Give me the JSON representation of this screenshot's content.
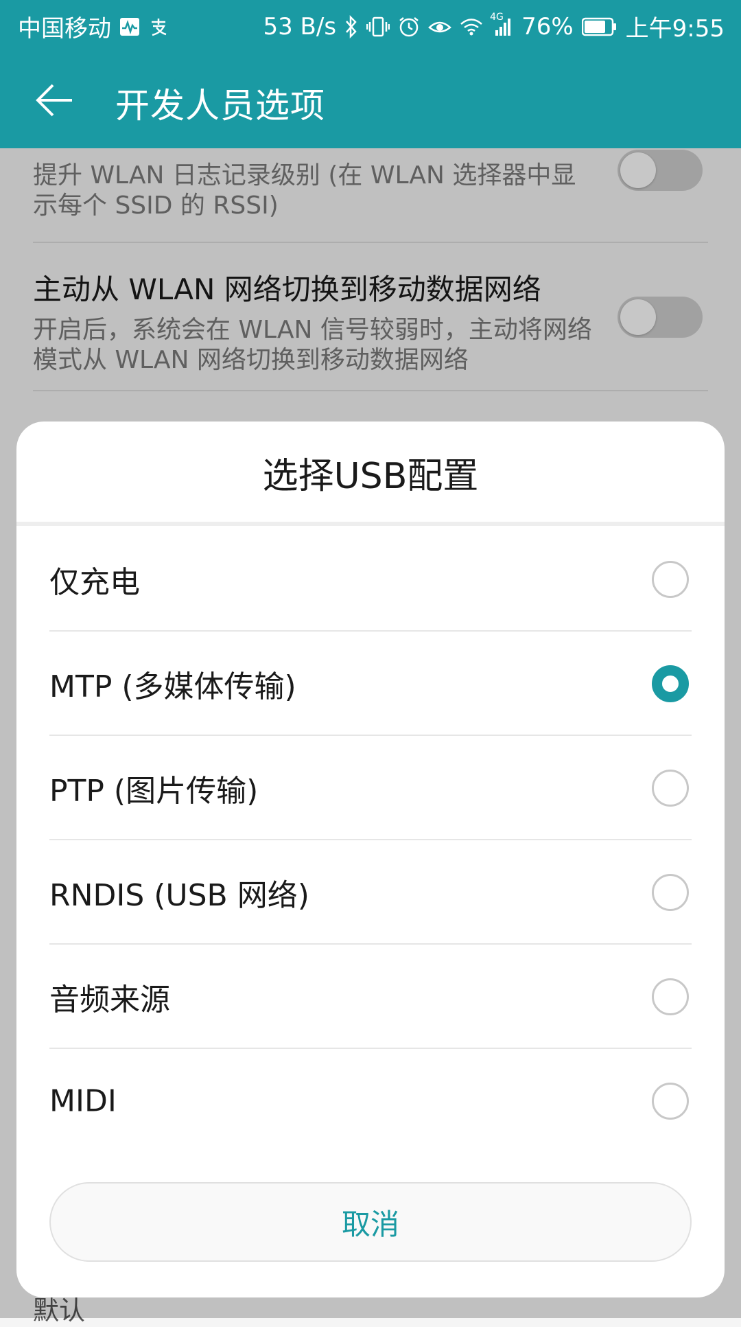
{
  "status_bar": {
    "carrier": "中国移动",
    "net_speed": "53 B/s",
    "network_type": "4G",
    "battery": "76%",
    "time": "上午9:55",
    "icons": [
      "activity-icon",
      "alipay-icon",
      "bluetooth-icon",
      "vibrate-icon",
      "alarm-icon",
      "eye-comfort-icon",
      "wifi-icon",
      "signal-icon",
      "battery-icon"
    ]
  },
  "app_bar": {
    "title": "开发人员选项",
    "back_icon": "arrow-left-icon"
  },
  "settings": {
    "items": [
      {
        "summary": "提升 WLAN 日志记录级别 (在 WLAN 选择器中显示每个 SSID 的 RSSI)",
        "enabled": false
      },
      {
        "title": "主动从 WLAN 网络切换到移动数据网络",
        "summary": "开启后，系统会在 WLAN 信号较弱时，主动将网络模式从 WLAN 网络切换到移动数据网络",
        "enabled": false
      }
    ],
    "bottom_peek": "默认"
  },
  "dialog": {
    "title": "选择USB配置",
    "options": [
      {
        "label": "仅充电",
        "selected": false
      },
      {
        "label": "MTP (多媒体传输)",
        "selected": true
      },
      {
        "label": "PTP (图片传输)",
        "selected": false
      },
      {
        "label": "RNDIS (USB 网络)",
        "selected": false
      },
      {
        "label": "音频来源",
        "selected": false
      },
      {
        "label": "MIDI",
        "selected": false
      }
    ],
    "cancel_label": "取消"
  },
  "colors": {
    "accent": "#1a9aa3",
    "text_primary": "#1a1a1a",
    "text_secondary": "#7a7a7a"
  }
}
